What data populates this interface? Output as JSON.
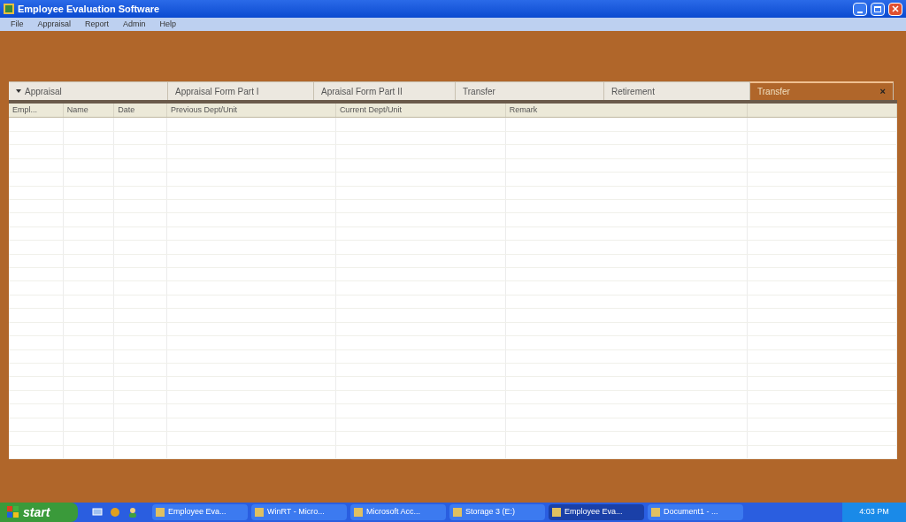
{
  "window": {
    "title": "Employee Evaluation Software"
  },
  "menu": [
    "File",
    "Appraisal",
    "Report",
    "Admin",
    "Help"
  ],
  "tabs": [
    {
      "label": "Appraisal",
      "selected": false,
      "kind": "dropdown"
    },
    {
      "label": "Appraisal Form Part I",
      "selected": false,
      "kind": "plain"
    },
    {
      "label": "Apraisal Form Part II",
      "selected": false,
      "kind": "plain"
    },
    {
      "label": "Transfer",
      "selected": false,
      "kind": "plain"
    },
    {
      "label": "Retirement",
      "selected": false,
      "kind": "plain"
    },
    {
      "label": "Transfer",
      "selected": true,
      "kind": "closable",
      "close": "×"
    }
  ],
  "table": {
    "columns": [
      "Empl...",
      "Name",
      "Date",
      "Previous Dept/Unit",
      "Current Dept/Unit",
      "Remark",
      ""
    ]
  },
  "taskbar": {
    "start": "start",
    "items": [
      {
        "label": "Employee Eva...",
        "selected": false
      },
      {
        "label": "WinRT - Micro...",
        "selected": false
      },
      {
        "label": "Microsoft Acc...",
        "selected": false
      },
      {
        "label": "Storage 3 (E:)",
        "selected": false
      },
      {
        "label": "Employee Eva...",
        "selected": true
      },
      {
        "label": "Document1 - ...",
        "selected": false
      }
    ],
    "clock": "4:03 PM"
  }
}
